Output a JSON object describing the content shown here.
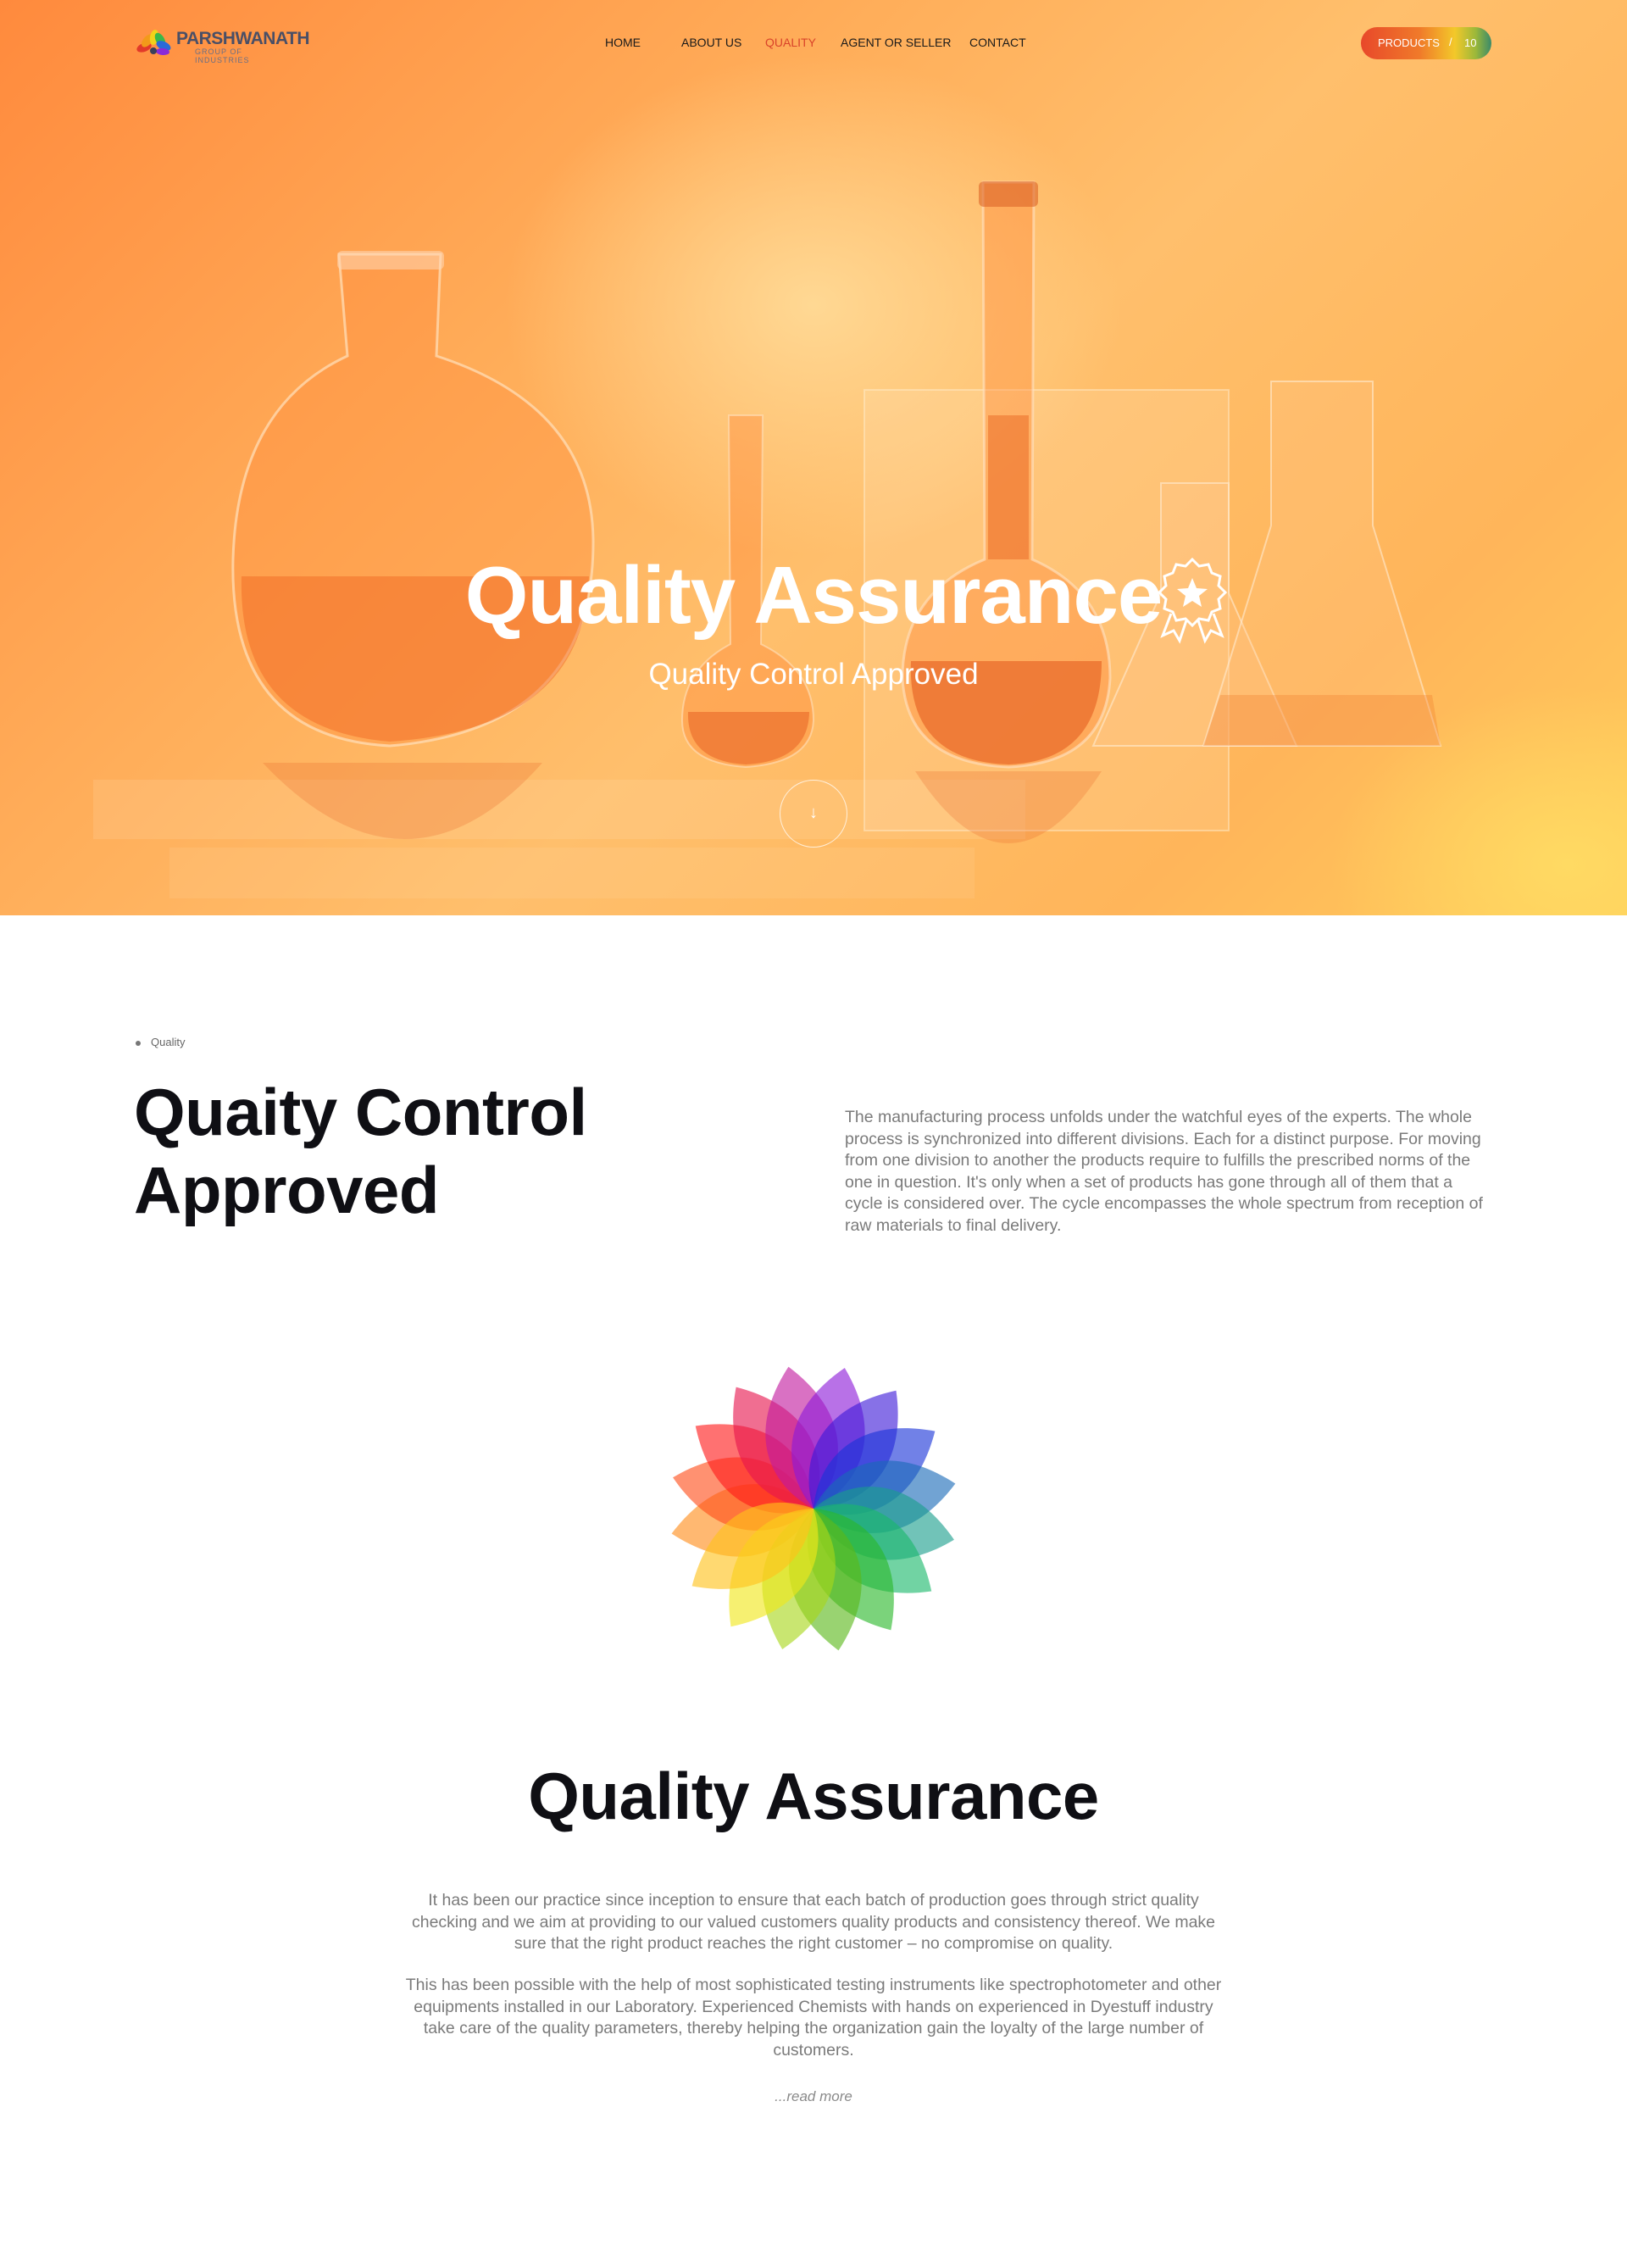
{
  "brand": {
    "name": "PARSHWANATH",
    "tagline": "GROUP OF INDUSTRIES"
  },
  "nav": {
    "items": [
      {
        "label": "HOME",
        "active": false
      },
      {
        "label": "ABOUT US",
        "active": false
      },
      {
        "label": "QUALITY",
        "active": true
      },
      {
        "label": "AGENT OR SELLER",
        "active": false
      },
      {
        "label": "CONTACT",
        "active": false
      }
    ],
    "products": {
      "label": "PRODUCTS",
      "separator": "/",
      "count": "10"
    }
  },
  "hero": {
    "title": "Quality Assurance",
    "subtitle": "Quality Control Approved",
    "scroll_icon": "arrow-down-icon",
    "badge_icon": "award-badge-icon"
  },
  "intro": {
    "breadcrumb": "Quality",
    "heading_line1": "Quaity Control",
    "heading_line2": "Approved",
    "text": "The manufacturing process unfolds under the watchful eyes of the experts. The whole process is synchronized into different divisions. Each for a distinct purpose. For moving from one division to another the products require to fulfills the prescribed norms of the one in question. It's only when a set of products has gone through all of them that a cycle is considered over. The cycle encompasses the whole spectrum from reception of raw materials to final delivery."
  },
  "qa": {
    "title": "Quality Assurance",
    "paragraph1": "It has been our practice since inception to ensure that each batch of production goes through strict quality checking and we aim at providing to our valued customers quality products and consistency thereof. We make sure that the right product reaches the right customer – no compromise on quality.",
    "paragraph2": "This has been possible with the help of most sophisticated testing instruments like spectrophotometer and other equipments installed in our Laboratory. Experienced Chemists with hands on experienced in Dyestuff industry take care of the quality parameters, thereby helping the organization gain the loyalty of the large number of customers.",
    "read_more": "...read more"
  },
  "colors": {
    "accent": "#d9432a",
    "hero_orange": "#ff9a45",
    "text_dark": "#0f0f14",
    "text_muted": "#7a7a7a",
    "flower": [
      "#ff8c1a",
      "#ff4d1a",
      "#ff1a1a",
      "#e6154d",
      "#c21a9e",
      "#8c1ad9",
      "#3d1ad9",
      "#1a33d9",
      "#1a6bb8",
      "#1a9e8c",
      "#1ab86b",
      "#2ab82a",
      "#5ab81a",
      "#a8d61a",
      "#f0e61a",
      "#ffc21a"
    ]
  }
}
